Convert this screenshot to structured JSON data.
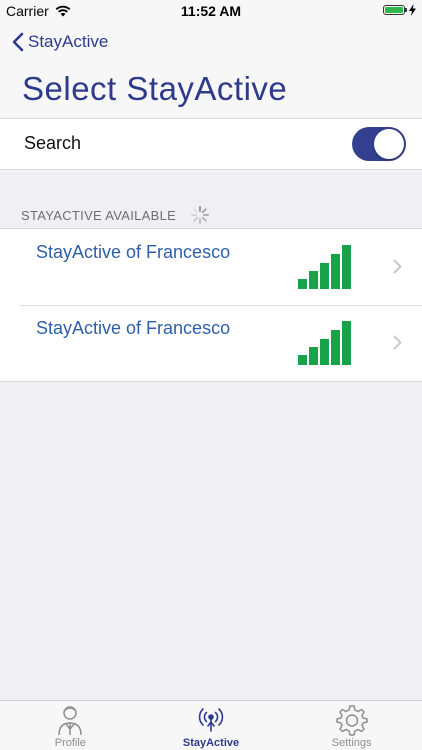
{
  "status_bar": {
    "carrier": "Carrier",
    "time": "11:52 AM"
  },
  "nav": {
    "back_label": "StayActive",
    "title": "Select StayActive"
  },
  "search": {
    "label": "Search",
    "enabled": true
  },
  "section": {
    "header": "STAYACTIVE AVAILABLE"
  },
  "devices": [
    {
      "name": "StayActive of Francesco",
      "signal_bars": 5
    },
    {
      "name": "StayActive of Francesco",
      "signal_bars": 5
    }
  ],
  "tabs": [
    {
      "label": "Profile",
      "icon": "profile-icon",
      "active": false
    },
    {
      "label": "StayActive",
      "icon": "broadcast-icon",
      "active": true
    },
    {
      "label": "Settings",
      "icon": "gear-icon",
      "active": false
    }
  ],
  "colors": {
    "accent": "#2e3a8c",
    "signal": "#16a34a",
    "link": "#2e5fa8",
    "background": "#efeff4"
  }
}
